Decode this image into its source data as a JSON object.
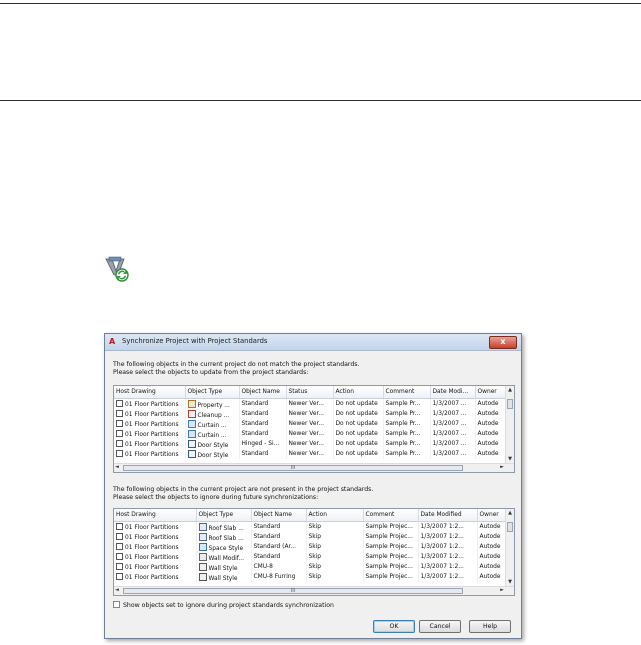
{
  "icon_names": {
    "sync": "synchronize-standards-icon",
    "app": "autocad-architecture-icon",
    "close": "close-icon"
  },
  "dialog": {
    "title": "Synchronize Project with Project Standards",
    "close_label": "x",
    "top_instruction_1": "The following objects in the current project do not match the project standards.",
    "top_instruction_2": "Please select the objects to update from the project standards:",
    "bottom_instruction_1": "The following objects in the current project are not present in the project standards.",
    "bottom_instruction_2": "Please select the objects to ignore during future synchronizations:",
    "checkbox_label": "Show objects set to ignore during project standards synchronization",
    "ok_label": "OK",
    "cancel_label": "Cancel",
    "help_label": "Help"
  },
  "top_grid": {
    "columns": [
      "Host Drawing",
      "Object Type",
      "Object Name",
      "Status",
      "Action",
      "Comment",
      "Date Modi...",
      "Owner"
    ],
    "rows": [
      [
        "01 Floor Partitions",
        "Property ...",
        "Standard",
        "Newer Ver...",
        "Do not update",
        "Sample Pr...",
        "1/3/2007 ...",
        "Autode"
      ],
      [
        "01 Floor Partitions",
        "Cleanup ...",
        "Standard",
        "Newer Ver...",
        "Do not update",
        "Sample Pr...",
        "1/3/2007 ...",
        "Autode"
      ],
      [
        "01 Floor Partitions",
        "Curtain ...",
        "Standard",
        "Newer Ver...",
        "Do not update",
        "Sample Pr...",
        "1/3/2007 ...",
        "Autode"
      ],
      [
        "01 Floor Partitions",
        "Curtain ...",
        "Standard",
        "Newer Ver...",
        "Do not update",
        "Sample Pr...",
        "1/3/2007 ...",
        "Autode"
      ],
      [
        "01 Floor Partitions",
        "Door Style",
        "Hinged - Si...",
        "Newer Ver...",
        "Do not update",
        "Sample Pr...",
        "1/3/2007 ...",
        "Autode"
      ],
      [
        "01 Floor Partitions",
        "Door Style",
        "Standard",
        "Newer Ver...",
        "Do not update",
        "Sample Pr...",
        "1/3/2007 ...",
        "Autode"
      ]
    ],
    "hscroll_label": "III"
  },
  "bottom_grid": {
    "columns": [
      "Host Drawing",
      "Object Type",
      "Object Name",
      "Action",
      "Comment",
      "Date Modified",
      "Owner"
    ],
    "rows": [
      [
        "01 Floor Partitions",
        "Roof Slab ...",
        "Standard",
        "Skip",
        "Sample Projec...",
        "1/3/2007 1:2...",
        "Autode"
      ],
      [
        "01 Floor Partitions",
        "Roof Slab ...",
        "Standard",
        "Skip",
        "Sample Projec...",
        "1/3/2007 1:2...",
        "Autode"
      ],
      [
        "01 Floor Partitions",
        "Space Style",
        "Standard (Ar...",
        "Skip",
        "Sample Projec...",
        "1/3/2007 1:2...",
        "Autode"
      ],
      [
        "01 Floor Partitions",
        "Wall Modif...",
        "Standard",
        "Skip",
        "Sample Projec...",
        "1/3/2007 1:2...",
        "Autode"
      ],
      [
        "01 Floor Partitions",
        "Wall Style",
        "CMU-8",
        "Skip",
        "Sample Projec...",
        "1/3/2007 1:2...",
        "Autode"
      ],
      [
        "01 Floor Partitions",
        "Wall Style",
        "CMU-8 Furring",
        "Skip",
        "Sample Projec...",
        "1/3/2007 1:2...",
        "Autode"
      ]
    ],
    "hscroll_label": "III"
  }
}
